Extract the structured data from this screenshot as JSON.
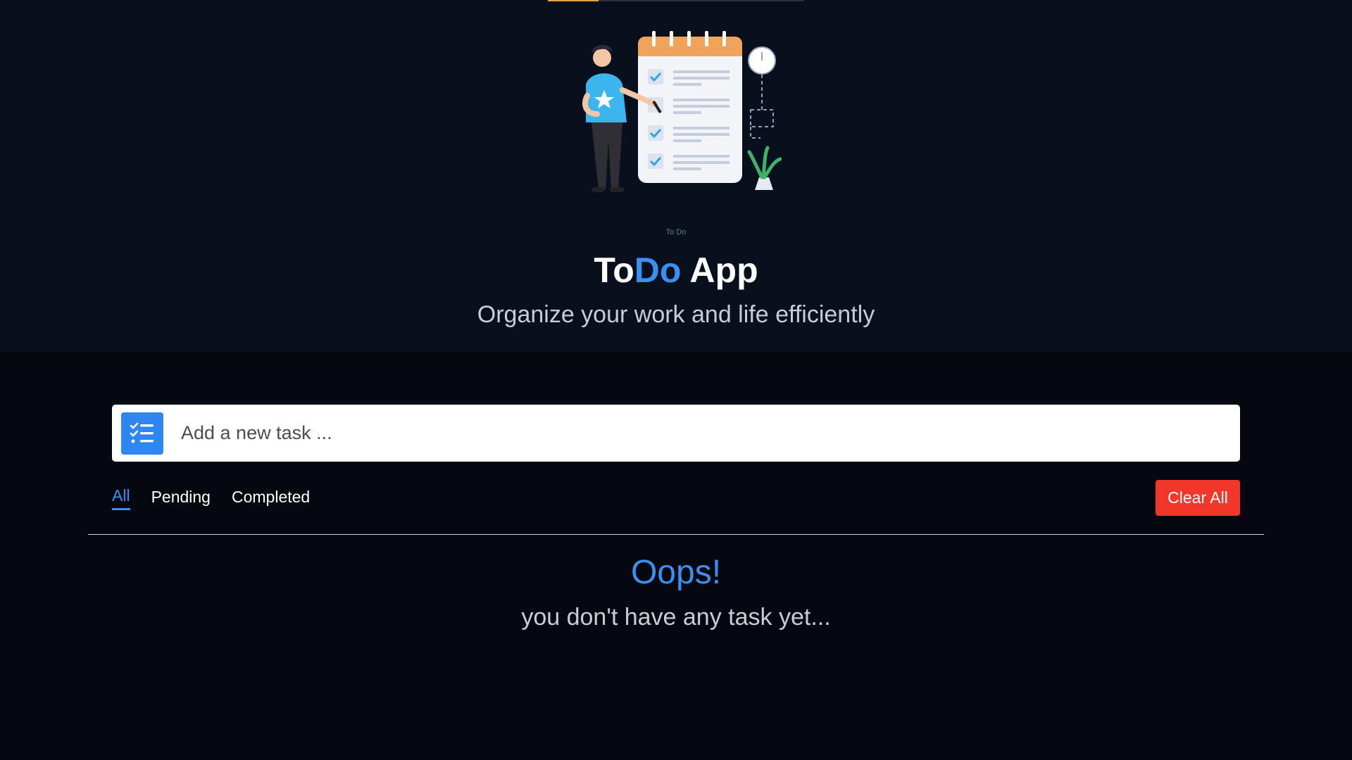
{
  "header": {
    "illustration_caption": "To Do",
    "title_part1": "To",
    "title_part2": "Do",
    "title_part3": " App",
    "subtitle": "Organize your work and life efficiently"
  },
  "task_input": {
    "placeholder": "Add a new task ...",
    "value": "",
    "icon": "task-list-icon"
  },
  "filters": {
    "items": [
      {
        "label": "All",
        "active": true
      },
      {
        "label": "Pending",
        "active": false
      },
      {
        "label": "Completed",
        "active": false
      }
    ]
  },
  "actions": {
    "clear_all_label": "Clear All"
  },
  "empty_state": {
    "title": "Oops!",
    "message": "you don't have any task yet..."
  },
  "colors": {
    "accent": "#3a8ff0",
    "danger": "#f2362c",
    "background": "#05090f",
    "header_background": "#07101c"
  }
}
